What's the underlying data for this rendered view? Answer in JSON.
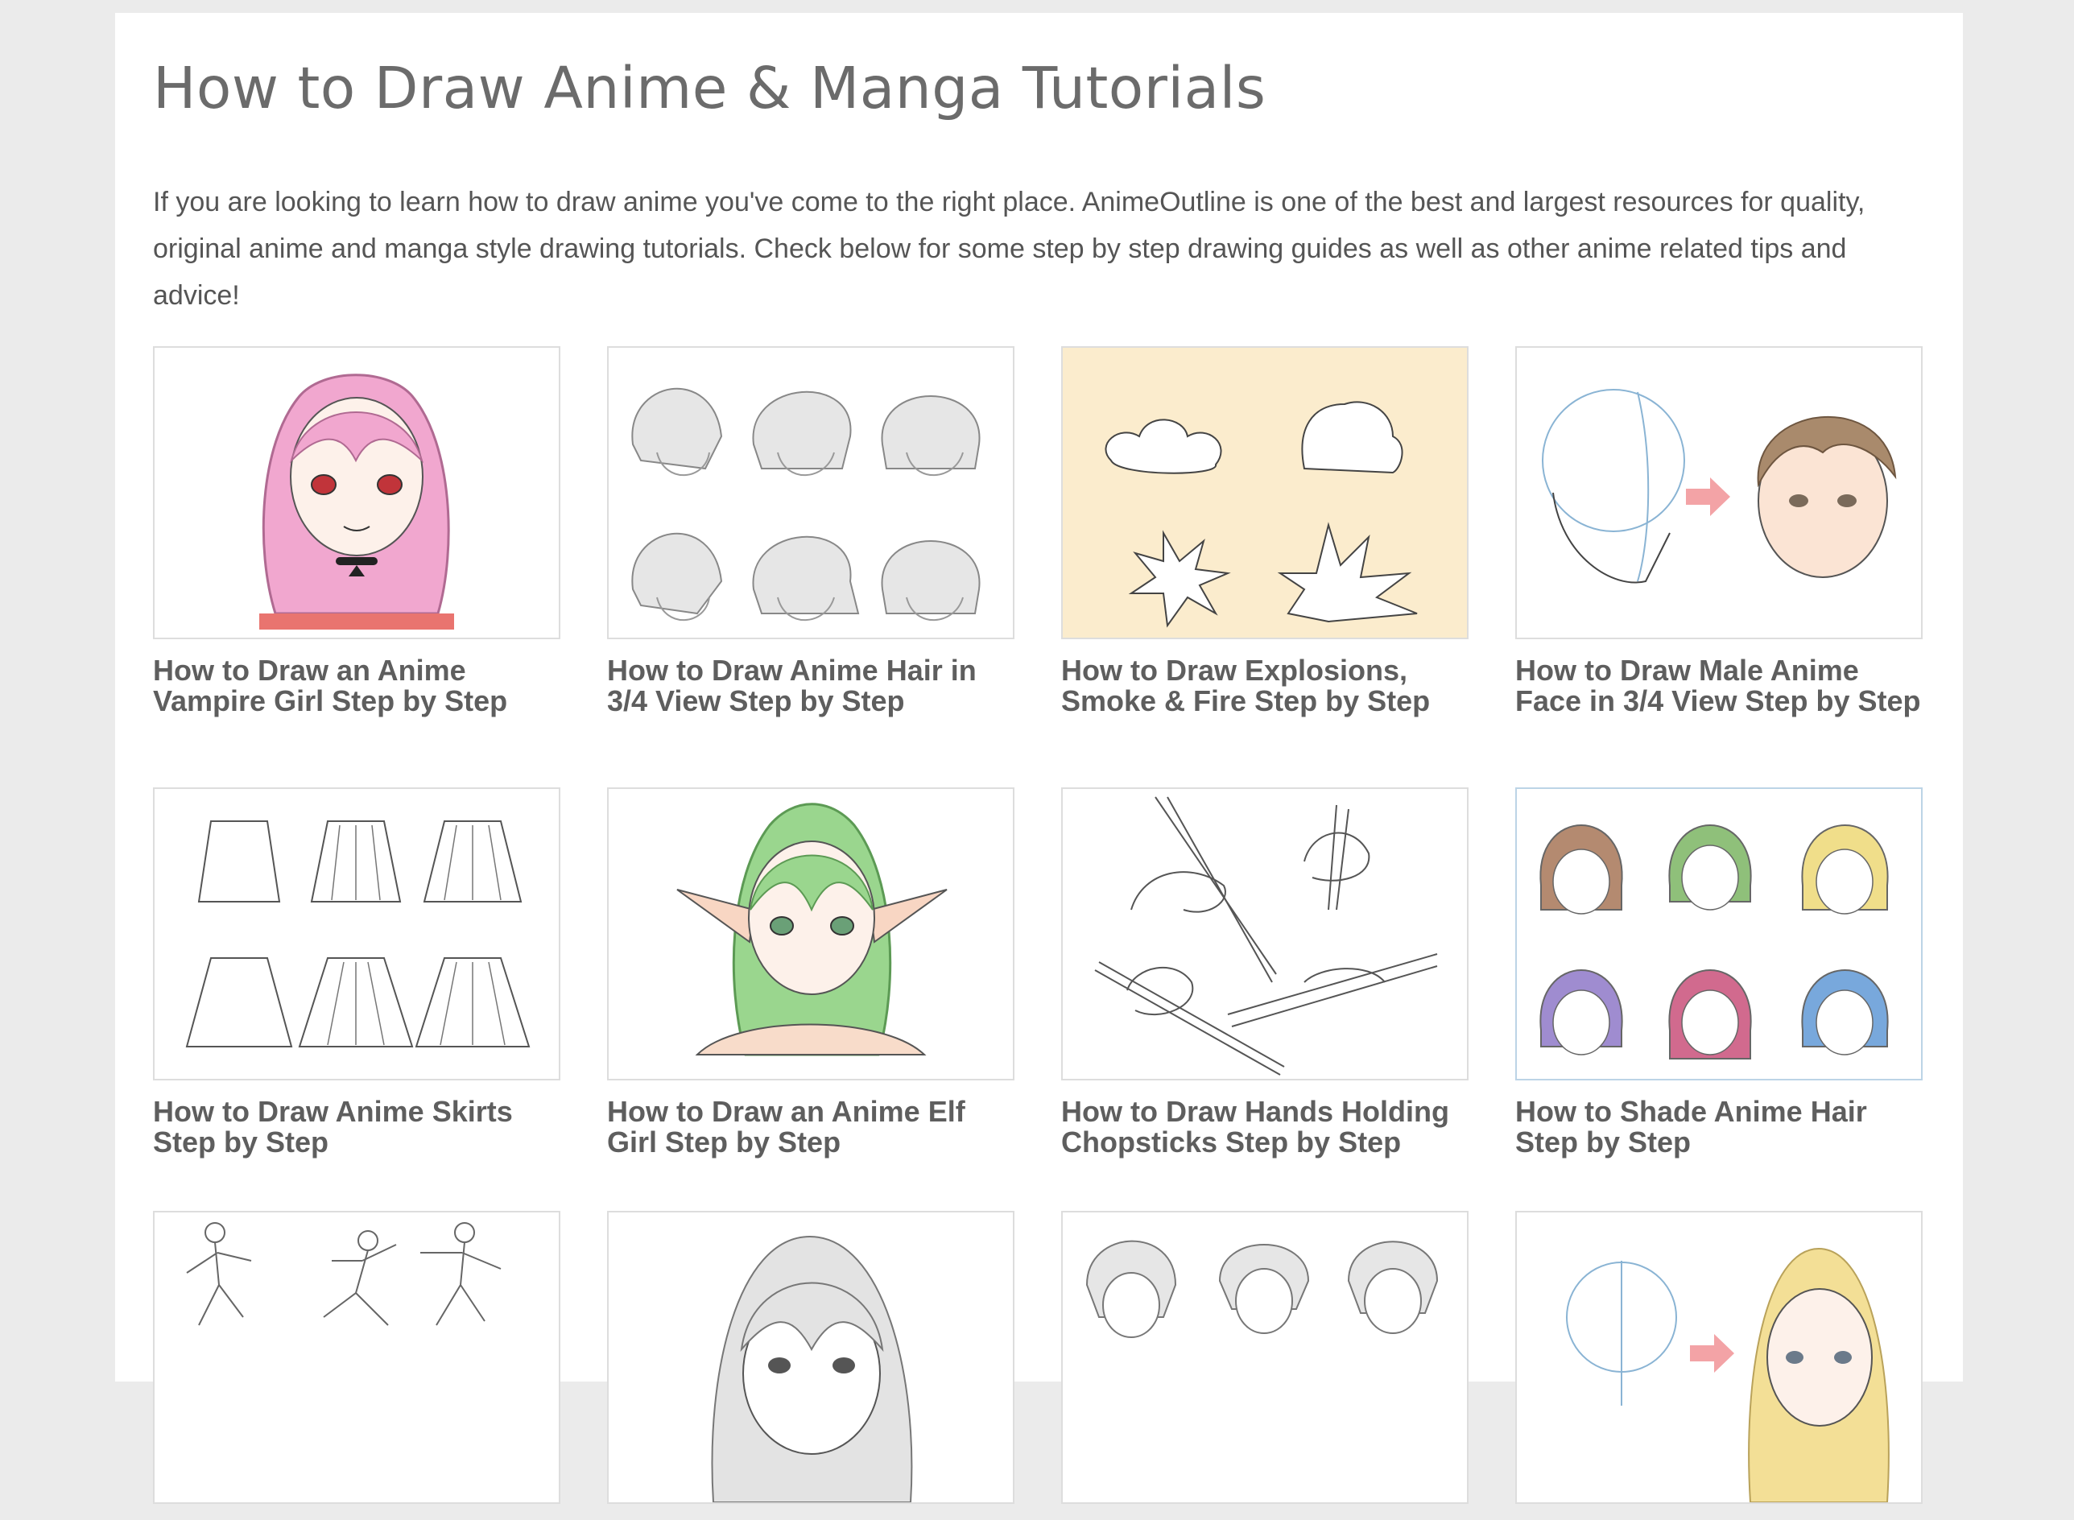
{
  "page": {
    "title": "How to Draw Anime & Manga Tutorials",
    "intro": "If you are looking to learn how to draw anime you've come to the right place. AnimeOutline is one of the best and largest resources for quality, original anime and manga style drawing tutorials. Check below for some step by step drawing guides as well as other anime related tips and advice!"
  },
  "tutorials": [
    {
      "title": "How to Draw an Anime Vampire Girl Step by Step"
    },
    {
      "title": "How to Draw Anime Hair in 3/4 View Step by Step"
    },
    {
      "title": "How to Draw Explosions, Smoke & Fire Step by Step"
    },
    {
      "title": "How to Draw Male Anime Face in 3/4 View Step by Step"
    },
    {
      "title": "How to Draw Anime Skirts Step by Step"
    },
    {
      "title": "How to Draw an Anime Elf Girl Step by Step"
    },
    {
      "title": "How to Draw Hands Holding Chopsticks Step by Step"
    },
    {
      "title": "How to Shade Anime Hair Step by Step"
    },
    {
      "title": ""
    },
    {
      "title": ""
    },
    {
      "title": ""
    },
    {
      "title": ""
    }
  ],
  "colors": {
    "background": "#ebebeb",
    "heading": "#6b6b6b",
    "text": "#555555",
    "explosion_bg": "#fbeccd",
    "vampire_hair": "#f1a7cf",
    "elf_hair": "#9ad68e",
    "arrow": "#f3a3a6"
  }
}
